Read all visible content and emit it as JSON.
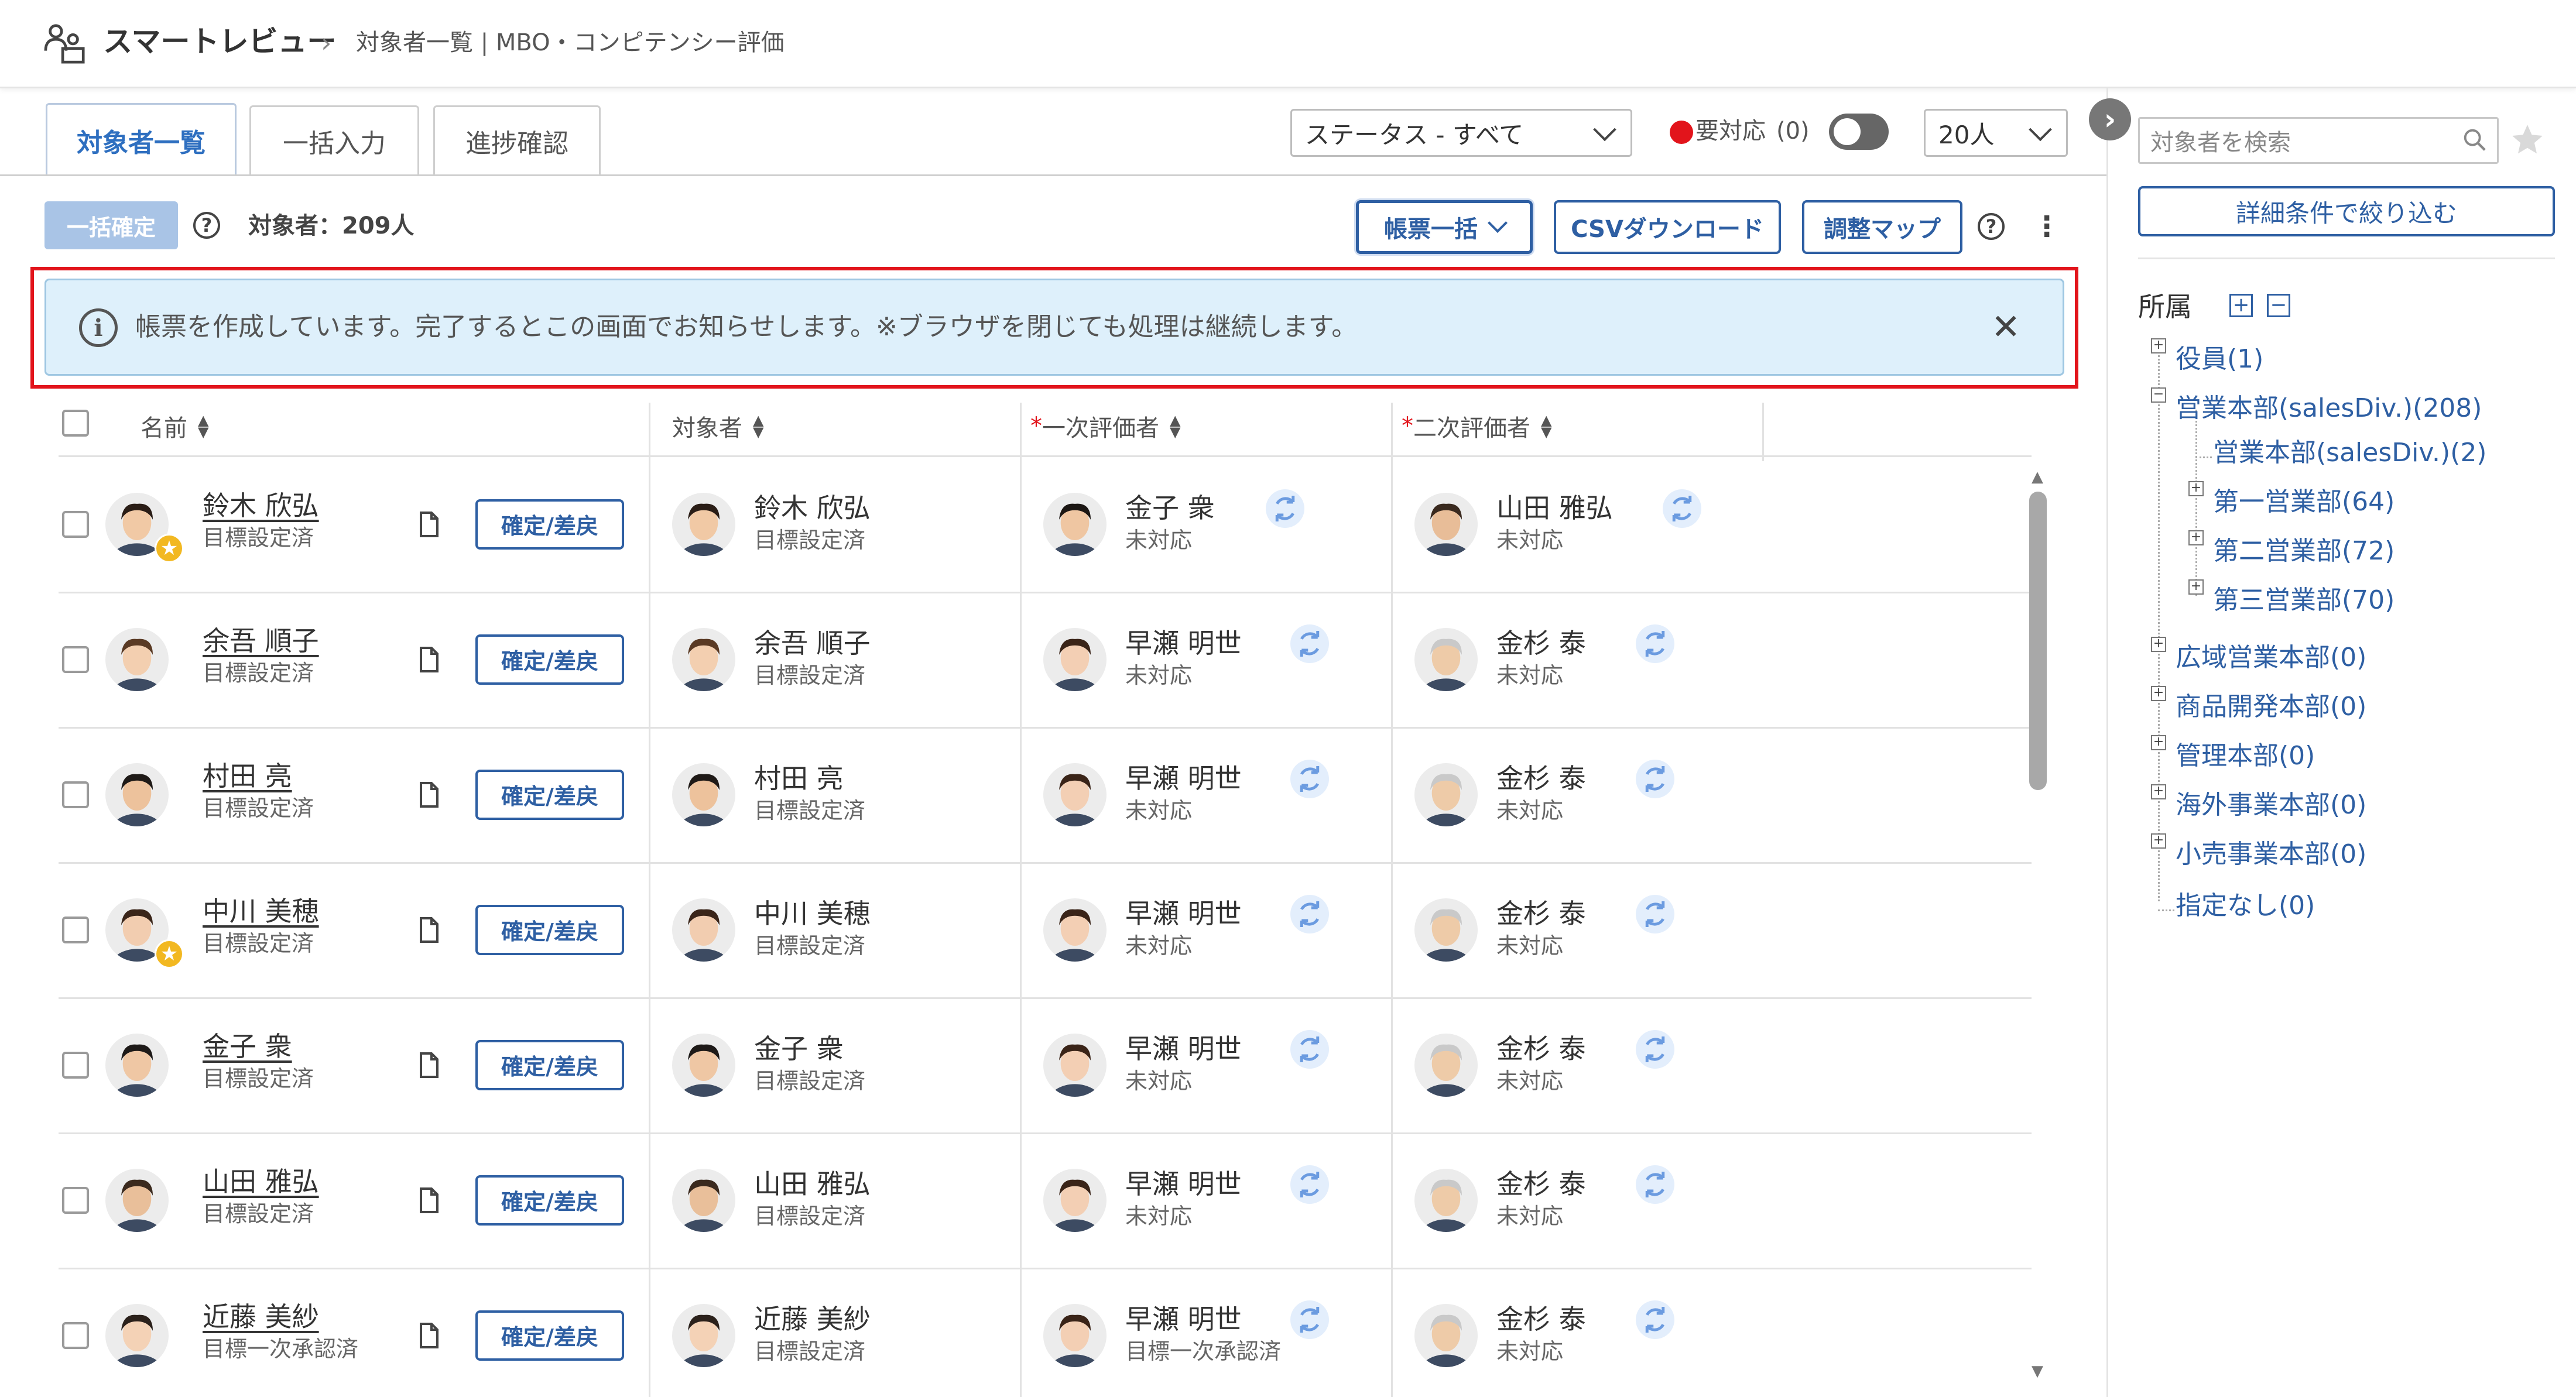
{
  "header": {
    "app_title": "スマートレビュー",
    "breadcrumb_sep": "›",
    "breadcrumb": "対象者一覧 | MBO・コンピテンシー評価"
  },
  "tabs": [
    {
      "label": "対象者一覧",
      "active": true
    },
    {
      "label": "一括入力",
      "active": false
    },
    {
      "label": "進捗確認",
      "active": false
    }
  ],
  "filters": {
    "status_select": "ステータス - すべて",
    "action_required_label": "要対応",
    "action_required_count": "(0)",
    "page_size": "20人"
  },
  "toolbar": {
    "bulk_confirm": "一括確定",
    "help": "?",
    "subject_count": "対象者：209人",
    "report_bulk": "帳票一括",
    "csv_download": "CSVダウンロード",
    "adjust_map": "調整マップ",
    "more": "⋮"
  },
  "banner": {
    "info": "i",
    "message": "帳票を作成しています。完了するとこの画面でお知らせします。※ブラウザを閉じても処理は継続します。",
    "close": "✕"
  },
  "table": {
    "headers": {
      "name": "名前",
      "subject": "対象者",
      "first_evaluator": "一次評価者",
      "second_evaluator": "二次評価者",
      "required_mark": "*"
    },
    "row_button": "確定/差戻",
    "rows": [
      {
        "name": "鈴木 欣弘",
        "status": "目標設定済",
        "subject": "鈴木 欣弘",
        "subject_status": "目標設定済",
        "eval1": "金子 衆",
        "eval1_status": "未対応",
        "eval2": "山田 雅弘",
        "eval2_status": "未対応",
        "star": true
      },
      {
        "name": "余吾 順子",
        "status": "目標設定済",
        "subject": "余吾 順子",
        "subject_status": "目標設定済",
        "eval1": "早瀬 明世",
        "eval1_status": "未対応",
        "eval2": "金杉 泰",
        "eval2_status": "未対応",
        "star": false
      },
      {
        "name": "村田 亮",
        "status": "目標設定済",
        "subject": "村田 亮",
        "subject_status": "目標設定済",
        "eval1": "早瀬 明世",
        "eval1_status": "未対応",
        "eval2": "金杉 泰",
        "eval2_status": "未対応",
        "star": false
      },
      {
        "name": "中川 美穂",
        "status": "目標設定済",
        "subject": "中川 美穂",
        "subject_status": "目標設定済",
        "eval1": "早瀬 明世",
        "eval1_status": "未対応",
        "eval2": "金杉 泰",
        "eval2_status": "未対応",
        "star": true
      },
      {
        "name": "金子 衆",
        "status": "目標設定済",
        "subject": "金子 衆",
        "subject_status": "目標設定済",
        "eval1": "早瀬 明世",
        "eval1_status": "未対応",
        "eval2": "金杉 泰",
        "eval2_status": "未対応",
        "star": false
      },
      {
        "name": "山田 雅弘",
        "status": "目標設定済",
        "subject": "山田 雅弘",
        "subject_status": "目標設定済",
        "eval1": "早瀬 明世",
        "eval1_status": "未対応",
        "eval2": "金杉 泰",
        "eval2_status": "未対応",
        "star": false
      },
      {
        "name": "近藤 美紗",
        "status": "目標一次承認済",
        "subject": "近藤 美紗",
        "subject_status": "目標設定済",
        "eval1": "早瀬 明世",
        "eval1_status": "目標一次承認済",
        "eval2": "金杉 泰",
        "eval2_status": "未対応",
        "star": false
      }
    ]
  },
  "panel": {
    "collapse": "›",
    "search_placeholder": "対象者を検索",
    "filter_button": "詳細条件で絞り込む",
    "tree_title": "所属",
    "expand_all": "+",
    "collapse_all": "−",
    "tree": [
      {
        "label": "役員(1)",
        "level": 0,
        "toggle": "+"
      },
      {
        "label": "営業本部(salesDiv.)(208)",
        "level": 0,
        "toggle": "−"
      },
      {
        "label": "営業本部(salesDiv.)(2)",
        "level": 1,
        "toggle": ""
      },
      {
        "label": "第一営業部(64)",
        "level": 1,
        "toggle": "+"
      },
      {
        "label": "第二営業部(72)",
        "level": 1,
        "toggle": "+"
      },
      {
        "label": "第三営業部(70)",
        "level": 1,
        "toggle": "+"
      },
      {
        "label": "広域営業本部(0)",
        "level": 0,
        "toggle": "+"
      },
      {
        "label": "商品開発本部(0)",
        "level": 0,
        "toggle": "+"
      },
      {
        "label": "管理本部(0)",
        "level": 0,
        "toggle": "+"
      },
      {
        "label": "海外事業本部(0)",
        "level": 0,
        "toggle": "+"
      },
      {
        "label": "小売事業本部(0)",
        "level": 0,
        "toggle": "+"
      },
      {
        "label": "指定なし(0)",
        "level": 0,
        "toggle": ""
      }
    ]
  },
  "colors": {
    "accent": "#2e5fa3",
    "banner_bg": "#def0fb",
    "highlight": "#e2141b",
    "status_dot": "#e2141b",
    "star": "#f2b821"
  }
}
